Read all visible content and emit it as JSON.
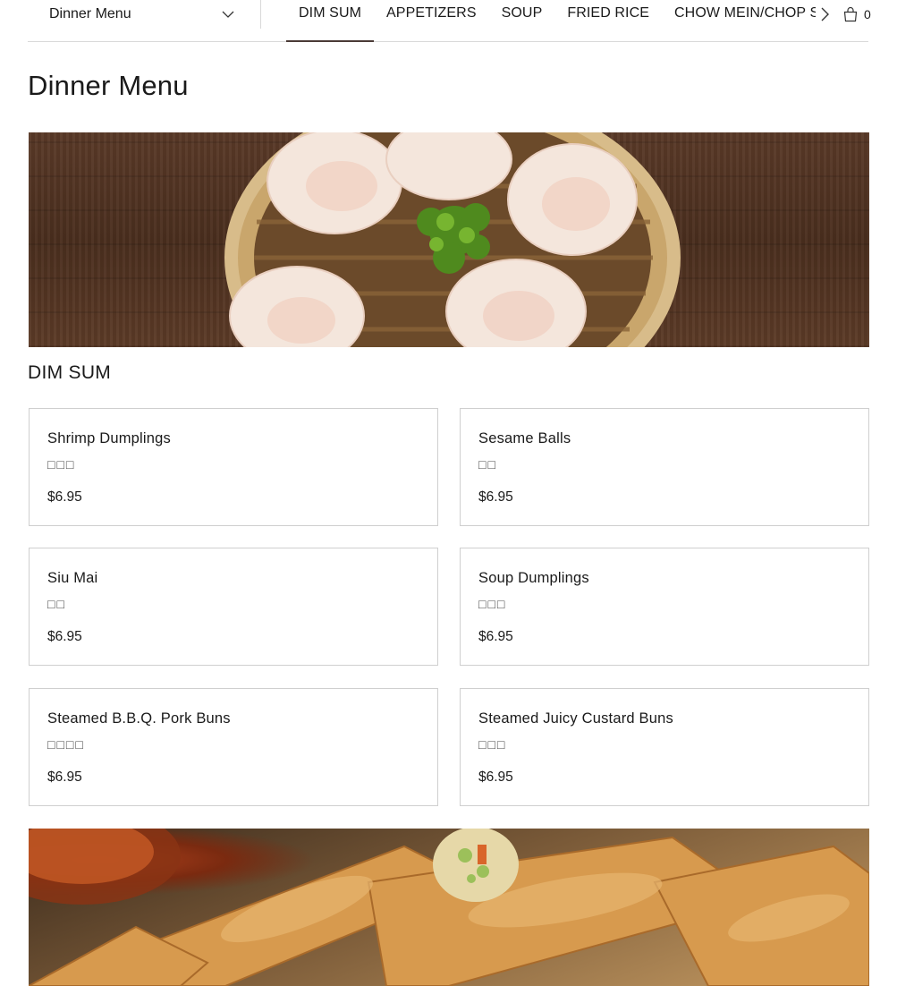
{
  "header": {
    "menu_selector": {
      "selected": "Dinner Menu",
      "icon": "chevron-down-icon"
    },
    "tabs": [
      {
        "label": "DIM SUM",
        "active": true
      },
      {
        "label": "APPETIZERS",
        "active": false
      },
      {
        "label": "SOUP",
        "active": false
      },
      {
        "label": "FRIED RICE",
        "active": false
      },
      {
        "label": "CHOW MEIN/CHOP SUEY",
        "active": false
      }
    ],
    "tabs_next_icon": "chevron-right-icon",
    "cart": {
      "icon": "shopping-bag-icon",
      "count": "0"
    }
  },
  "page": {
    "title": "Dinner Menu"
  },
  "sections": [
    {
      "title": "DIM SUM",
      "items": [
        {
          "name": "Shrimp Dumplings",
          "chinese": "□□□",
          "price": "$6.95"
        },
        {
          "name": "Sesame Balls",
          "chinese": "□□",
          "price": "$6.95"
        },
        {
          "name": "Siu Mai",
          "chinese": "□□",
          "price": "$6.95"
        },
        {
          "name": "Soup Dumplings",
          "chinese": "□□□",
          "price": "$6.95"
        },
        {
          "name": "Steamed B.B.Q. Pork Buns",
          "chinese": "□□□□",
          "price": "$6.95"
        },
        {
          "name": "Steamed Juicy Custard Buns",
          "chinese": "□□□",
          "price": "$6.95"
        }
      ]
    }
  ],
  "colors": {
    "active_tab_underline": "#4a3a36",
    "card_border": "#cfcfcf",
    "text": "#1a1a1a"
  }
}
